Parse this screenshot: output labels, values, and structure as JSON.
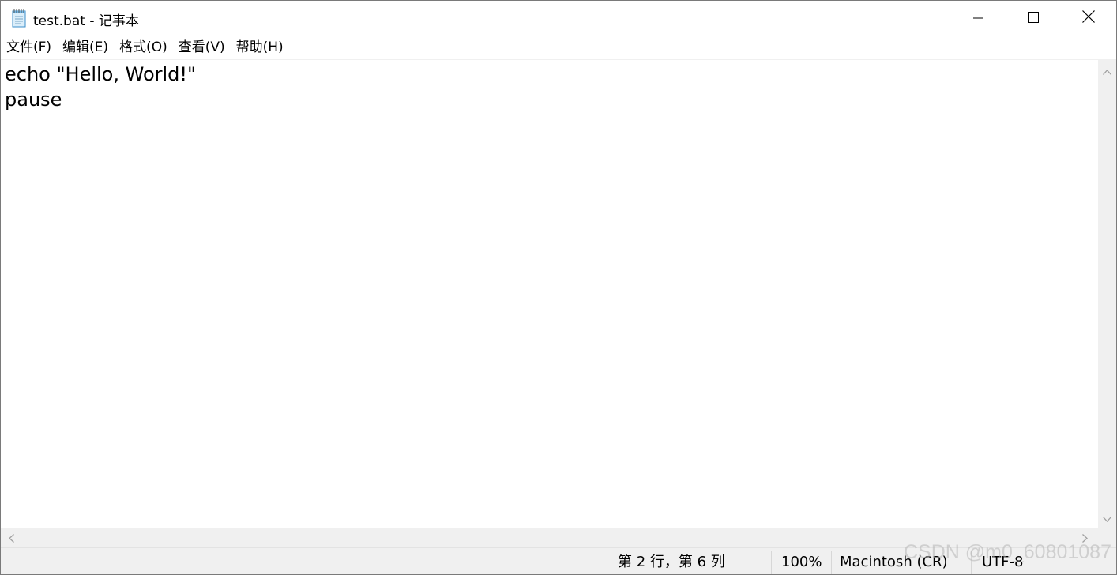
{
  "window": {
    "title": "test.bat - 记事本",
    "app_icon": "notepad-icon"
  },
  "window_controls": {
    "minimize_icon": "minimize-icon",
    "maximize_icon": "maximize-icon",
    "close_icon": "close-icon"
  },
  "menu": {
    "items": [
      {
        "label": "文件(F)"
      },
      {
        "label": "编辑(E)"
      },
      {
        "label": "格式(O)"
      },
      {
        "label": "查看(V)"
      },
      {
        "label": "帮助(H)"
      }
    ]
  },
  "editor": {
    "lines": [
      "echo \"Hello, World!\"",
      "pause"
    ]
  },
  "scrollbars": {
    "up_icon": "chevron-up-icon",
    "down_icon": "chevron-down-icon",
    "left_icon": "chevron-left-icon",
    "right_icon": "chevron-right-icon"
  },
  "status": {
    "position": "第 2 行，第 6 列",
    "zoom": "100%",
    "line_ending": "Macintosh (CR)",
    "encoding": "UTF-8"
  },
  "watermark": "CSDN @m0_60801087",
  "colors": {
    "chrome_bg": "#f0f0f0",
    "editor_bg": "#ffffff",
    "text": "#000000"
  }
}
